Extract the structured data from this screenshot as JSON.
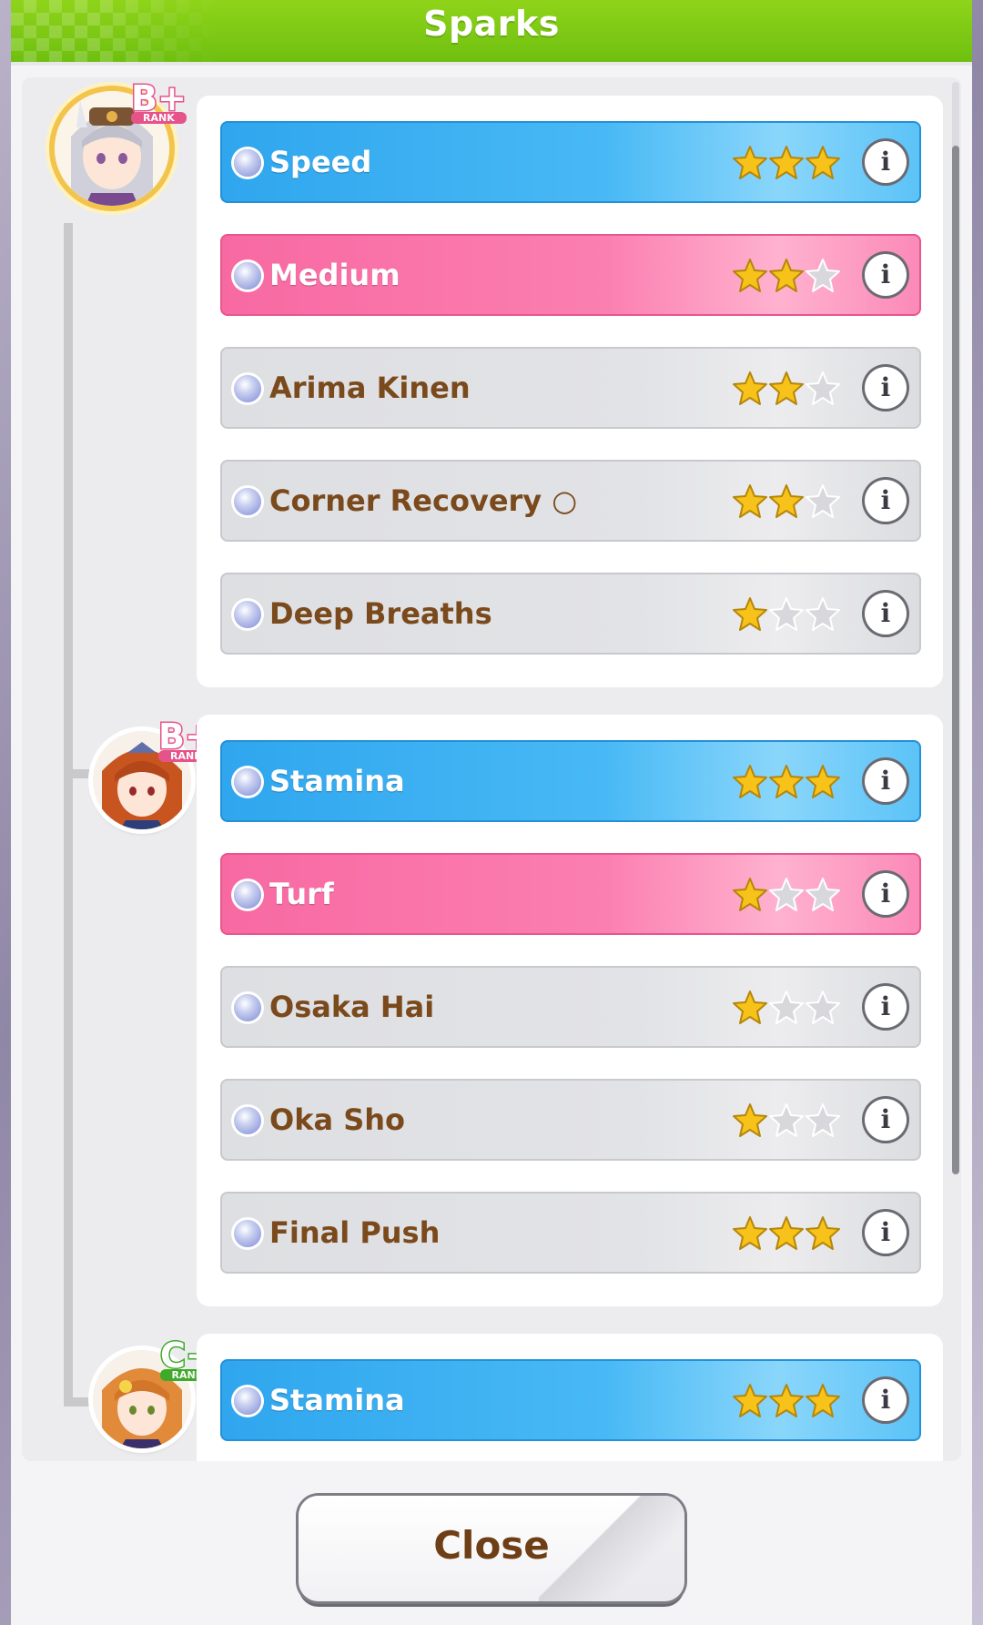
{
  "dialog": {
    "title": "Sparks",
    "close_label": "Close"
  },
  "colors": {
    "header_green": "#7ccb12",
    "stat_blue": "#3db0f2",
    "aptitude_pink": "#fa74aa",
    "skill_gray": "#e0e1e4",
    "text_brown": "#7a4a1c",
    "star_gold": "#f7c21a",
    "star_empty": "#d8d8dc"
  },
  "parents": [
    {
      "rank": "B+",
      "rank_sub": "RANK",
      "sparks": [
        {
          "label": "Speed",
          "type": "blue",
          "stars": 3
        },
        {
          "label": "Medium",
          "type": "pink",
          "stars": 2
        },
        {
          "label": "Arima Kinen",
          "type": "gray",
          "stars": 2
        },
        {
          "label": "Corner Recovery ○",
          "type": "gray",
          "stars": 2
        },
        {
          "label": "Deep Breaths",
          "type": "gray",
          "stars": 1
        }
      ]
    },
    {
      "rank": "B+",
      "rank_sub": "RANK",
      "sparks": [
        {
          "label": "Stamina",
          "type": "blue",
          "stars": 3
        },
        {
          "label": "Turf",
          "type": "pink",
          "stars": 1
        },
        {
          "label": "Osaka Hai",
          "type": "gray",
          "stars": 1
        },
        {
          "label": "Oka Sho",
          "type": "gray",
          "stars": 1
        },
        {
          "label": "Final Push",
          "type": "gray",
          "stars": 3
        }
      ]
    },
    {
      "rank": "C+",
      "rank_sub": "RANK",
      "sparks": [
        {
          "label": "Stamina",
          "type": "blue",
          "stars": 3
        }
      ]
    }
  ],
  "icons": {
    "info": "i",
    "star": "star-icon",
    "bullet": "spark-bullet-icon"
  }
}
